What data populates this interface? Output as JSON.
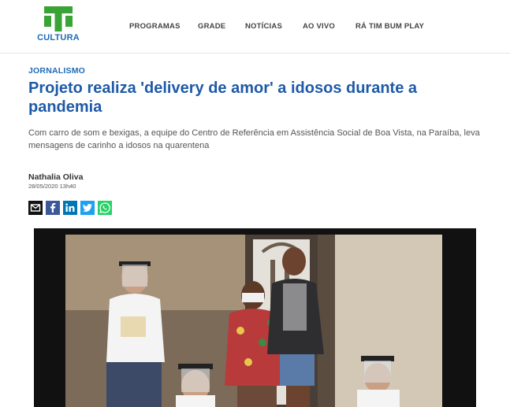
{
  "header": {
    "logo_text": "CULTURA",
    "nav": [
      {
        "label": "PROGRAMAS"
      },
      {
        "label": "GRADE"
      },
      {
        "label": "NOTÍCIAS"
      },
      {
        "label": "AO VIVO"
      },
      {
        "label": "RÁ TIM BUM PLAY"
      }
    ]
  },
  "article": {
    "category": "JORNALISMO",
    "title": "Projeto realiza 'delivery de amor' a idosos durante a pandemia",
    "subtitle": "Com carro de som e bexigas, a equipe do Centro de Referência em Assistência Social de Boa Vista, na Paraíba, leva mensagens de carinho a idosos na quarentena",
    "author": "Nathalia Oliva",
    "date": "28/05/2020 13h40"
  },
  "share": [
    {
      "icon": "email-icon",
      "color": "#111111"
    },
    {
      "icon": "facebook-icon",
      "color": "#3b5998"
    },
    {
      "icon": "linkedin-icon",
      "color": "#0077b5"
    },
    {
      "icon": "twitter-icon",
      "color": "#1da1f2"
    },
    {
      "icon": "whatsapp-icon",
      "color": "#25d366"
    }
  ],
  "colors": {
    "brand_green": "#3aa335",
    "brand_blue": "#1e6bb8",
    "headline_blue": "#1e5aa8"
  }
}
